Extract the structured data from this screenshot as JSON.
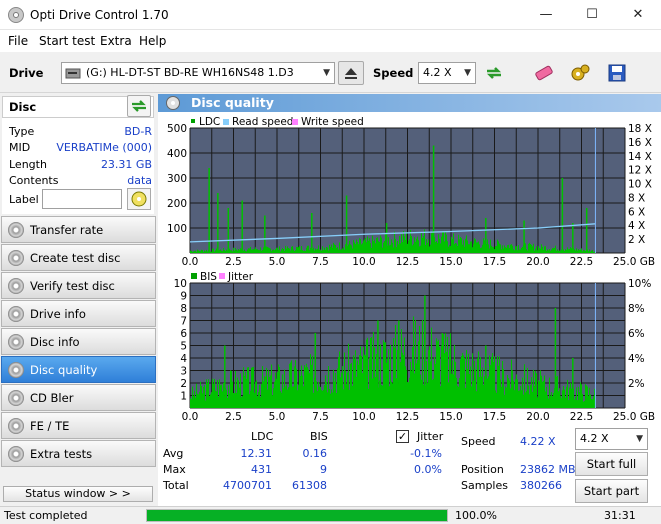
{
  "window": {
    "title": "Opti Drive Control 1.70",
    "minimize": "—",
    "maximize": "☐",
    "close": "✕"
  },
  "menu": [
    "File",
    "Start test",
    "Extra",
    "Help"
  ],
  "toolbar": {
    "drive_label": "Drive",
    "drive_value": "(G:)   HL-DT-ST BD-RE  WH16NS48 1.D3",
    "speed_label": "Speed",
    "speed_value": "4.2 X"
  },
  "disc": {
    "header": "Disc",
    "rows": [
      {
        "key": "Type",
        "value": "BD-R"
      },
      {
        "key": "MID",
        "value": "VERBATIMe (000)"
      },
      {
        "key": "Length",
        "value": "23.31 GB"
      },
      {
        "key": "Contents",
        "value": "data"
      }
    ],
    "label_key": "Label",
    "label_value": ""
  },
  "nav": [
    {
      "label": "Transfer rate",
      "active": false
    },
    {
      "label": "Create test disc",
      "active": false
    },
    {
      "label": "Verify test disc",
      "active": false
    },
    {
      "label": "Drive info",
      "active": false
    },
    {
      "label": "Disc info",
      "active": false
    },
    {
      "label": "Disc quality",
      "active": true
    },
    {
      "label": "CD Bler",
      "active": false
    },
    {
      "label": "FE / TE",
      "active": false
    },
    {
      "label": "Extra tests",
      "active": false
    }
  ],
  "status_window_label": "Status window > >",
  "panel_title": "Disc quality",
  "colors": {
    "ldc": "#00c000",
    "read_speed": "#87cefa",
    "write_speed": "#ff80ff",
    "jitter": "#ff80ff",
    "plot_bg": "#54607a",
    "grid": "#000000",
    "accent": "#2f7fd8"
  },
  "chart_data": [
    {
      "type": "area",
      "legend": [
        "LDC",
        "Read speed",
        "Write speed"
      ],
      "x_ticks": [
        "0.0",
        "2.5",
        "5.0",
        "7.5",
        "10.0",
        "12.5",
        "15.0",
        "17.5",
        "20.0",
        "22.5",
        "25.0 GB"
      ],
      "y_ticks_left": [
        "500",
        "400",
        "300",
        "200",
        "100"
      ],
      "y_ticks_right": [
        "18 X",
        "16 X",
        "14 X",
        "12 X",
        "10 X",
        "8 X",
        "6 X",
        "4 X",
        "2 X"
      ],
      "xlim": [
        0,
        25
      ],
      "ylim": [
        0,
        500
      ],
      "y2lim": [
        0,
        18
      ],
      "ldc_x": [
        0,
        1,
        2,
        3,
        4,
        5,
        6,
        7,
        8,
        9,
        10,
        11,
        12,
        13,
        14,
        15,
        16,
        17,
        18,
        19,
        20,
        21,
        22,
        23,
        23.3
      ],
      "ldc_base": [
        8,
        10,
        12,
        14,
        16,
        16,
        18,
        20,
        24,
        30,
        38,
        46,
        54,
        62,
        58,
        48,
        42,
        36,
        30,
        26,
        22,
        18,
        14,
        10,
        6
      ],
      "ldc_spikes": [
        [
          1.1,
          340
        ],
        [
          1.6,
          240
        ],
        [
          2.2,
          180
        ],
        [
          3.0,
          210
        ],
        [
          4.3,
          150
        ],
        [
          7.0,
          160
        ],
        [
          9.0,
          230
        ],
        [
          11.3,
          120
        ],
        [
          14.0,
          430
        ],
        [
          17.0,
          140
        ],
        [
          19.2,
          130
        ],
        [
          21.4,
          300
        ],
        [
          22.0,
          120
        ],
        [
          22.8,
          180
        ]
      ],
      "read_speed": [
        [
          0,
          1.6
        ],
        [
          5,
          2.1
        ],
        [
          10,
          2.7
        ],
        [
          15,
          3.1
        ],
        [
          20,
          3.6
        ],
        [
          23.3,
          4.2
        ]
      ]
    },
    {
      "type": "area",
      "legend": [
        "BIS",
        "Jitter"
      ],
      "x_ticks": [
        "0.0",
        "2.5",
        "5.0",
        "7.5",
        "10.0",
        "12.5",
        "15.0",
        "17.5",
        "20.0",
        "22.5",
        "25.0 GB"
      ],
      "y_ticks_left": [
        "10",
        "9",
        "8",
        "7",
        "6",
        "5",
        "4",
        "3",
        "2",
        "1"
      ],
      "y_ticks_right": [
        "10%",
        "8%",
        "6%",
        "4%",
        "2%"
      ],
      "xlim": [
        0,
        25
      ],
      "ylim": [
        0,
        10
      ],
      "bis_x": [
        0,
        1,
        2,
        3,
        4,
        5,
        6,
        7,
        8,
        9,
        10,
        11,
        12,
        13,
        14,
        15,
        16,
        17,
        18,
        19,
        20,
        21,
        22,
        23,
        23.3
      ],
      "bis_base": [
        1,
        1.5,
        1.8,
        2,
        2,
        2.2,
        2.4,
        2.6,
        2.8,
        3,
        3.4,
        3.8,
        4.2,
        4.6,
        4.2,
        3.6,
        3.2,
        2.8,
        2.4,
        2.2,
        1.8,
        1.6,
        1.4,
        1.2,
        1
      ],
      "bis_spikes": [
        [
          2.0,
          5
        ],
        [
          7.2,
          6
        ],
        [
          10.8,
          7
        ],
        [
          12.0,
          7
        ],
        [
          13.5,
          9
        ],
        [
          14.5,
          6
        ],
        [
          17.0,
          5
        ],
        [
          21.0,
          8
        ],
        [
          22.0,
          4
        ]
      ]
    }
  ],
  "stats": {
    "col_ldc": "LDC",
    "col_bis": "BIS",
    "col_jitter": "Jitter",
    "rows": [
      {
        "label": "Avg",
        "ldc": "12.31",
        "bis": "0.16",
        "jitter": "-0.1%"
      },
      {
        "label": "Max",
        "ldc": "431",
        "bis": "9",
        "jitter": "0.0%"
      },
      {
        "label": "Total",
        "ldc": "4700701",
        "bis": "61308",
        "jitter": ""
      }
    ],
    "speed_label": "Speed",
    "speed_value": "4.22 X",
    "position_label": "Position",
    "position_value": "23862 MB",
    "samples_label": "Samples",
    "samples_value": "380266",
    "speed_select": "4.2 X",
    "start_full": "Start full",
    "start_part": "Start part"
  },
  "status": {
    "text": "Test completed",
    "progress": 100.0,
    "progress_text": "100.0%",
    "time": "31:31"
  }
}
